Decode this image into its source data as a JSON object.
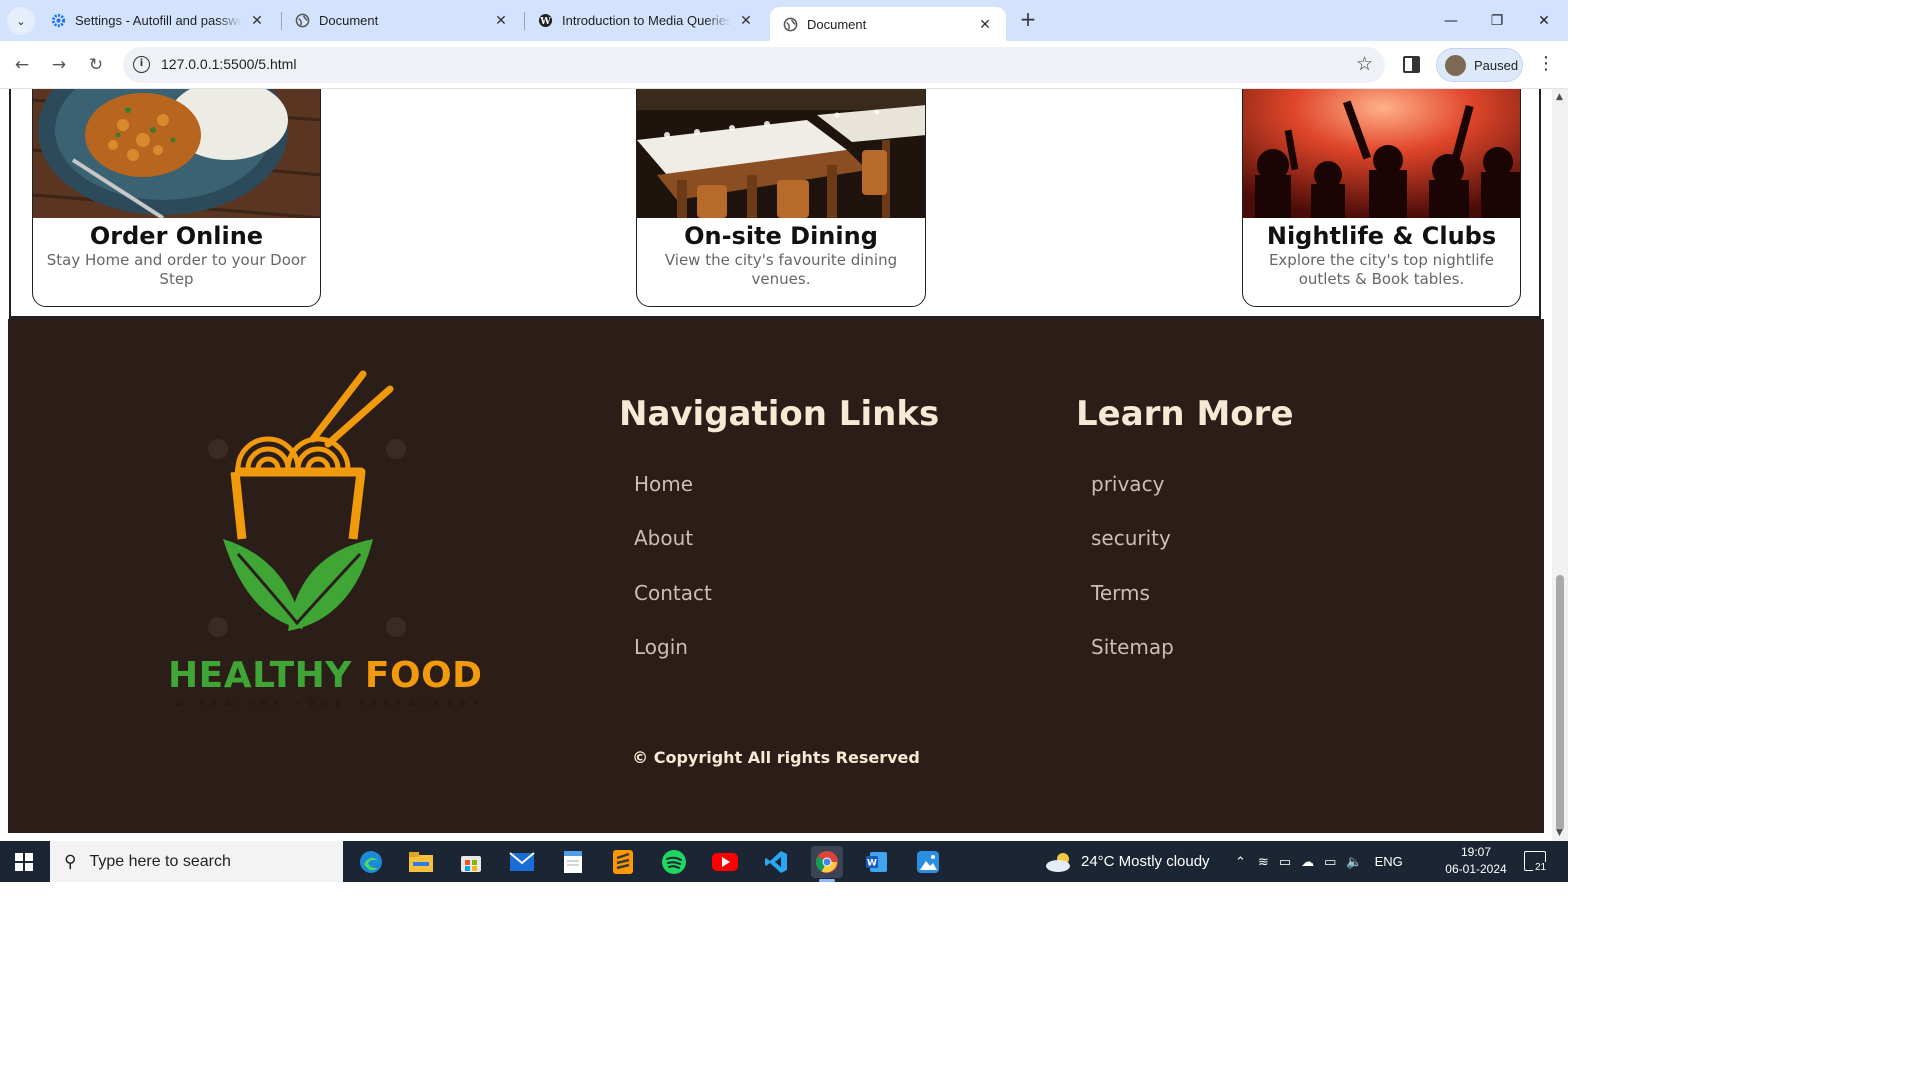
{
  "browser": {
    "tabs": [
      {
        "title": "Settings - Autofill and passwords",
        "icon": "gear-icon",
        "active": false
      },
      {
        "title": "Document",
        "icon": "globe-icon",
        "active": false
      },
      {
        "title": "Introduction to Media Queries -",
        "icon": "wordpress-icon",
        "active": false
      },
      {
        "title": "Document",
        "icon": "globe-icon",
        "active": true
      }
    ],
    "url": "127.0.0.1:5500/5.html",
    "profile_label": "Paused"
  },
  "cards": [
    {
      "title": "Order Online",
      "desc": "Stay Home and order to your Door Step"
    },
    {
      "title": "On-site Dining",
      "desc": "View the city's favourite dining venues."
    },
    {
      "title": "Nightlife & Clubs",
      "desc": "Explore the city's top nightlife outlets & Book tables."
    }
  ],
  "footer": {
    "logo": {
      "word1": "HEALTHY",
      "word2": "FOOD",
      "tagline": "A HEALTHY FOOD RESTAURANT"
    },
    "nav_heading": "Navigation Links",
    "nav_links": [
      "Home",
      "About",
      "Contact",
      "Login"
    ],
    "learn_heading": "Learn More",
    "learn_links": [
      "privacy",
      "security",
      "Terms",
      "Sitemap"
    ],
    "copyright": "© Copyright All rights Reserved"
  },
  "taskbar": {
    "search_placeholder": "Type here to search",
    "weather": "24°C  Mostly cloudy",
    "language": "ENG",
    "time": "19:07",
    "date": "06-01-2024",
    "notification_count": "21"
  },
  "colors": {
    "footer_bg": "#2b1d18",
    "heading": "#f7ead4",
    "logo_green": "#3fa535",
    "logo_orange": "#f29a0d"
  }
}
